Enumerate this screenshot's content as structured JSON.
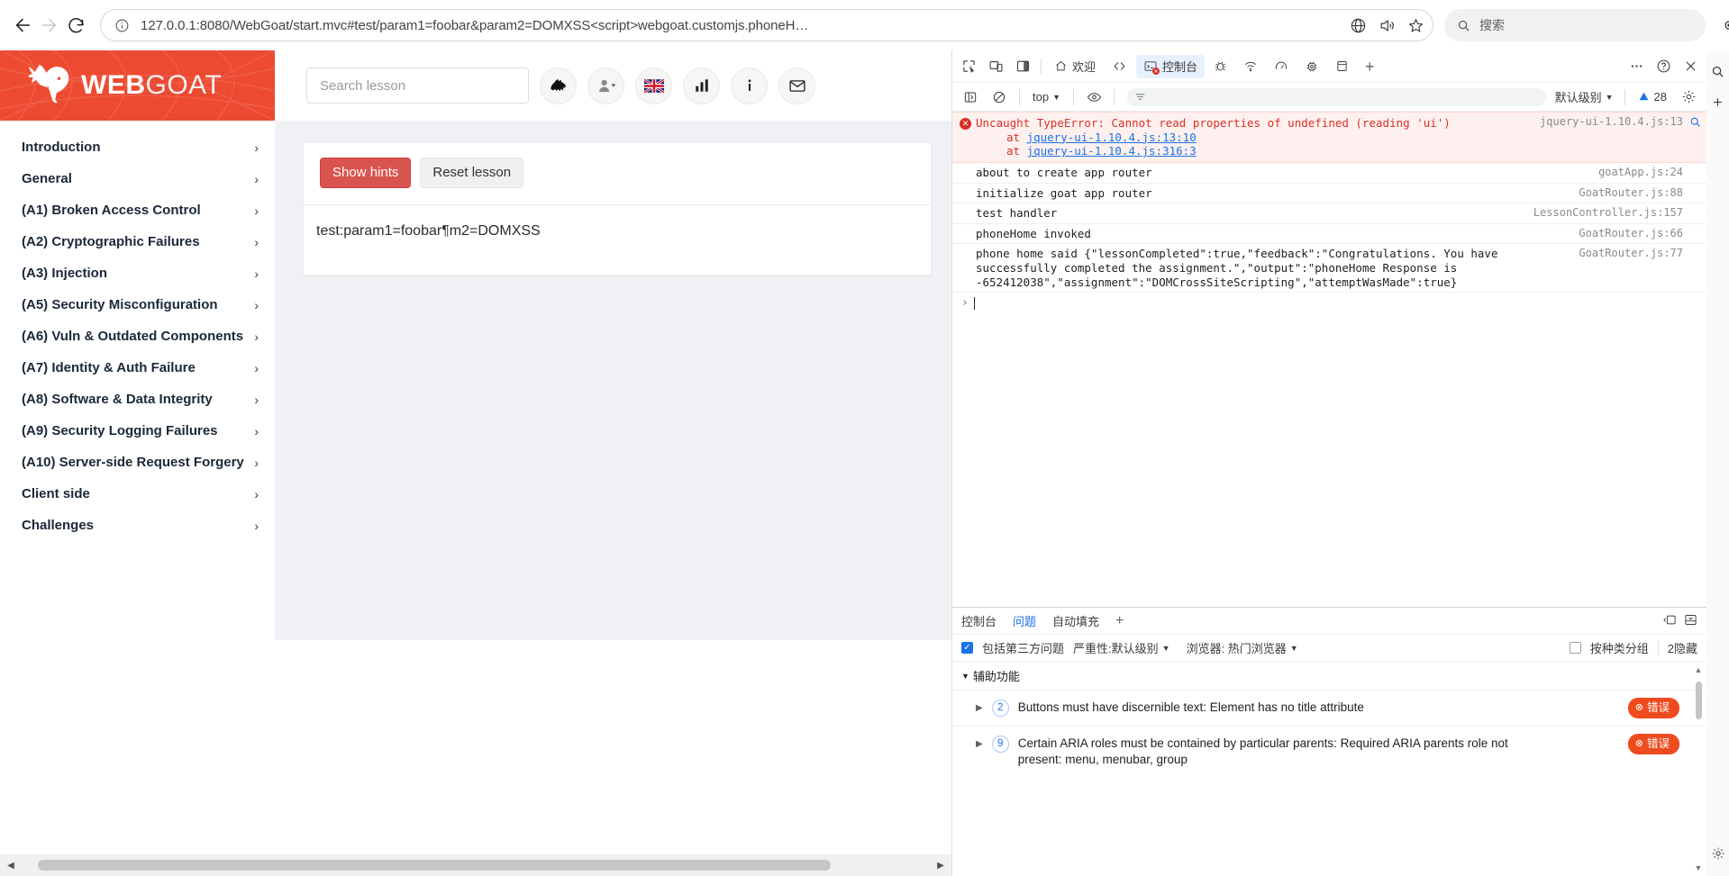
{
  "browser": {
    "back_icon": "back-arrow-icon",
    "forward_icon": "forward-arrow-icon",
    "refresh_icon": "refresh-icon",
    "url": "127.0.0.1:8080/WebGoat/start.mvc#test/param1=foobar&param2=DOMXSS<script>webgoat.customjs.phoneH…",
    "search_placeholder": "搜索",
    "icons": {
      "info": "info-icon",
      "translate": "translate-icon",
      "read_aloud": "read-aloud-icon",
      "favorite": "star-icon",
      "copilot": "copilot-icon",
      "collections": "collections-icon",
      "browser_essentials": "edge-essentials-icon",
      "settings_more": "more-options-icon",
      "split_screen": "split-screen-icon"
    }
  },
  "webgoat": {
    "logo": {
      "word1": "WEB",
      "word2": "GOAT",
      "brand_color": "#ec4b32"
    },
    "search": {
      "placeholder": "Search lesson"
    },
    "header_icons": [
      {
        "name": "lesson-progress-icon",
        "glyph": "wolf"
      },
      {
        "name": "user-menu-icon",
        "glyph": "user"
      },
      {
        "name": "language-selector-icon",
        "glyph": "uk-flag"
      },
      {
        "name": "report-card-icon",
        "glyph": "chart"
      },
      {
        "name": "about-icon",
        "glyph": "info"
      },
      {
        "name": "contact-icon",
        "glyph": "envelope"
      }
    ],
    "menu": [
      {
        "label": "Introduction"
      },
      {
        "label": "General"
      },
      {
        "label": "(A1) Broken Access Control"
      },
      {
        "label": "(A2) Cryptographic Failures"
      },
      {
        "label": "(A3) Injection"
      },
      {
        "label": "(A5) Security Misconfiguration"
      },
      {
        "label": "(A6) Vuln & Outdated Components"
      },
      {
        "label": "(A7) Identity & Auth Failure"
      },
      {
        "label": "(A8) Software & Data Integrity"
      },
      {
        "label": "(A9) Security Logging Failures"
      },
      {
        "label": "(A10) Server-side Request Forgery"
      },
      {
        "label": "Client side"
      },
      {
        "label": "Challenges"
      }
    ],
    "lesson": {
      "show_hints_label": "Show hints",
      "reset_lesson_label": "Reset lesson",
      "output_text": "test:param1=foobar¶m2=DOMXSS"
    }
  },
  "devtools": {
    "tabs": [
      {
        "label": "欢迎",
        "icon": "home-icon",
        "active": false
      },
      {
        "label": "",
        "icon": "elements-code-icon",
        "active": false
      },
      {
        "label": "控制台",
        "icon": "console-icon",
        "active": true
      },
      {
        "label": "",
        "icon": "sources-bug-icon",
        "active": false
      },
      {
        "label": "",
        "icon": "network-icon",
        "active": false
      },
      {
        "label": "",
        "icon": "performance-icon",
        "active": false
      },
      {
        "label": "",
        "icon": "memory-icon",
        "active": false
      },
      {
        "label": "",
        "icon": "application-icon",
        "active": false
      }
    ],
    "tab_add_label": "+",
    "left_icons": [
      "inspect-icon",
      "device-toolbar-icon",
      "dock-side-icon"
    ],
    "right_icons": [
      "more-tools-icon",
      "help-icon",
      "close-icon"
    ],
    "console_toolbar": {
      "sidebar_icon": "console-sidebar-icon",
      "clear_icon": "clear-console-icon",
      "context": "top",
      "eye_icon": "live-expression-icon",
      "filter_placeholder": "",
      "level": "默认级别",
      "issues_count": "28",
      "settings_icon": "console-settings-icon"
    },
    "console_messages": [
      {
        "type": "error",
        "text": "Uncaught TypeError: Cannot read properties of undefined (reading 'ui')",
        "source": "jquery-ui-1.10.4.js:13",
        "stack": [
          "at jquery-ui-1.10.4.js:13:10",
          "at jquery-ui-1.10.4.js:316:3"
        ],
        "stack_links": [
          "jquery-ui-1.10.4.js:13:10",
          "jquery-ui-1.10.4.js:316:3"
        ]
      },
      {
        "type": "log",
        "text": "about to create app router",
        "source": "goatApp.js:24"
      },
      {
        "type": "log",
        "text": "initialize goat app router",
        "source": "GoatRouter.js:88"
      },
      {
        "type": "log",
        "text": "test handler",
        "source": "LessonController.js:157"
      },
      {
        "type": "log",
        "text": "phoneHome invoked",
        "source": "GoatRouter.js:66"
      },
      {
        "type": "log",
        "text": "phone home said {\"lessonCompleted\":true,\"feedback\":\"Congratulations. You have successfully completed the assignment.\",\"output\":\"phoneHome Response is -652412038\",\"assignment\":\"DOMCrossSiteScripting\",\"attemptWasMade\":true}",
        "source": "GoatRouter.js:77"
      }
    ],
    "prompt_caret": "›",
    "drawer": {
      "tabs": [
        {
          "label": "控制台",
          "active": false
        },
        {
          "label": "问题",
          "active": true
        },
        {
          "label": "自动填充",
          "active": false
        }
      ],
      "add_label": "+",
      "right_icons": [
        "dock-drawer-icon",
        "move-to-bottom-icon"
      ],
      "filters": {
        "third_party_label": "包括第三方问题",
        "third_party_checked": true,
        "severity_label": "严重性:默认级别",
        "browser_label": "浏览器: 热门浏览器",
        "group_by_kind_label": "按种类分组",
        "group_by_kind_checked": false,
        "hidden_label": "2隐藏"
      },
      "group_title": "辅助功能",
      "issues": [
        {
          "count": "2",
          "text": "Buttons must have discernible text: Element has no title attribute",
          "badge": "错误"
        },
        {
          "count": "9",
          "text": "Certain ARIA roles must be contained by particular parents: Required ARIA parents role not present: menu, menubar, group",
          "badge": "错误"
        }
      ]
    }
  }
}
